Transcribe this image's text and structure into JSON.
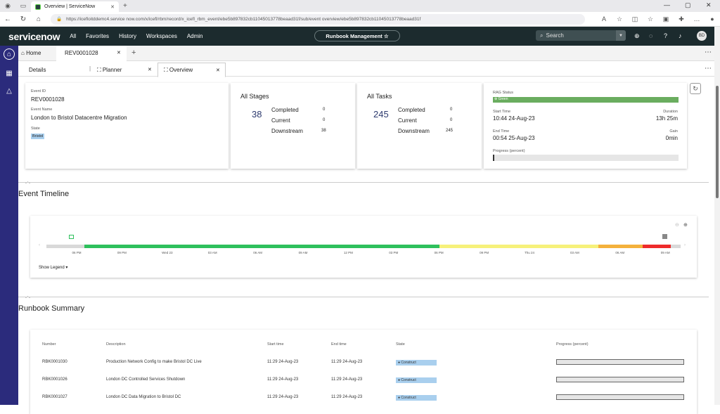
{
  "browser": {
    "tab_title": "Overview | ServiceNow",
    "new_tab": "+",
    "url": "https://icefloitddemc4.service now.com/x/icefl/rbm/record/x_icefl_rbm_event/ebe5b897832cb11045013778beaad31f/sub/event overview/ebe5b897832cb11045013778beaad31f"
  },
  "header": {
    "logo": "servicenow",
    "nav": [
      "All",
      "Favorites",
      "History",
      "Workspaces",
      "Admin"
    ],
    "workspace_pill": "Runbook Management ☆",
    "search_placeholder": "Search",
    "avatar_initials": "BD"
  },
  "workspace_tabs": {
    "home": "Home",
    "record": "REV0001028",
    "add": "+"
  },
  "sub_tabs": {
    "details": "Details",
    "planner": "Planner",
    "overview": "Overview"
  },
  "event": {
    "id_label": "Event ID",
    "id": "REV0001028",
    "name_label": "Event Name",
    "name": "London to Bristol Datacentre Migration",
    "state_label": "State",
    "state": "Bristol"
  },
  "stages": {
    "title": "All Stages",
    "total": "38",
    "completed_label": "Completed",
    "completed": "0",
    "current_label": "Current",
    "current": "0",
    "downstream_label": "Downstream",
    "downstream": "38"
  },
  "tasks": {
    "title": "All Tasks",
    "total": "245",
    "completed_label": "Completed",
    "completed": "0",
    "current_label": "Current",
    "current": "0",
    "downstream_label": "Downstream",
    "downstream": "245"
  },
  "rag": {
    "status_label": "RAG Status",
    "status": "Green",
    "status_color": "#6aad5f",
    "start_label": "Start Time",
    "start": "10:44 24-Aug-23",
    "duration_label": "Duration",
    "duration": "13h 25m",
    "end_label": "End Time",
    "end": "00:54 25-Aug-23",
    "gain_label": "Gain",
    "gain": "0min",
    "progress_label": "Progress (percent)",
    "progress": 0
  },
  "timeline": {
    "title": "Event Timeline",
    "ticks": [
      "06 PM",
      "09 PM",
      "Wed 23",
      "03 AM",
      "06 AM",
      "09 AM",
      "12 PM",
      "03 PM",
      "06 PM",
      "09 PM",
      "Thu 24",
      "03 AM",
      "06 AM",
      "09 AM"
    ],
    "segments": [
      {
        "from": 0,
        "to": 0.06,
        "color": "#d9d9d9"
      },
      {
        "from": 0.06,
        "to": 0.62,
        "color": "#2ec05c"
      },
      {
        "from": 0.62,
        "to": 0.87,
        "color": "#f6f17a"
      },
      {
        "from": 0.87,
        "to": 0.94,
        "color": "#f4b13c"
      },
      {
        "from": 0.94,
        "to": 0.985,
        "color": "#ee2b2b"
      },
      {
        "from": 0.985,
        "to": 1,
        "color": "#d9d9d9"
      }
    ],
    "show_legend": "Show Legend ▾"
  },
  "summary": {
    "title": "Runbook Summary",
    "columns": [
      "Number",
      "Description",
      "Start time",
      "End time",
      "State",
      "Progress (percent)"
    ],
    "rows": [
      {
        "number": "RBK0001030",
        "description": "Production Network Config to make Bristol DC Live",
        "start": "11:29 24-Aug-23",
        "end": "11:29 24-Aug-23",
        "state": "Construct",
        "progress": 0
      },
      {
        "number": "RBK0001026",
        "description": "London DC Controlled Services Shutdown",
        "start": "11:29 24-Aug-23",
        "end": "11:29 24-Aug-23",
        "state": "Construct",
        "progress": 0
      },
      {
        "number": "RBK0001027",
        "description": "London DC Data Migration to Bristol DC",
        "start": "11:29 24-Aug-23",
        "end": "11:29 24-Aug-23",
        "state": "Construct",
        "progress": 0
      }
    ]
  }
}
